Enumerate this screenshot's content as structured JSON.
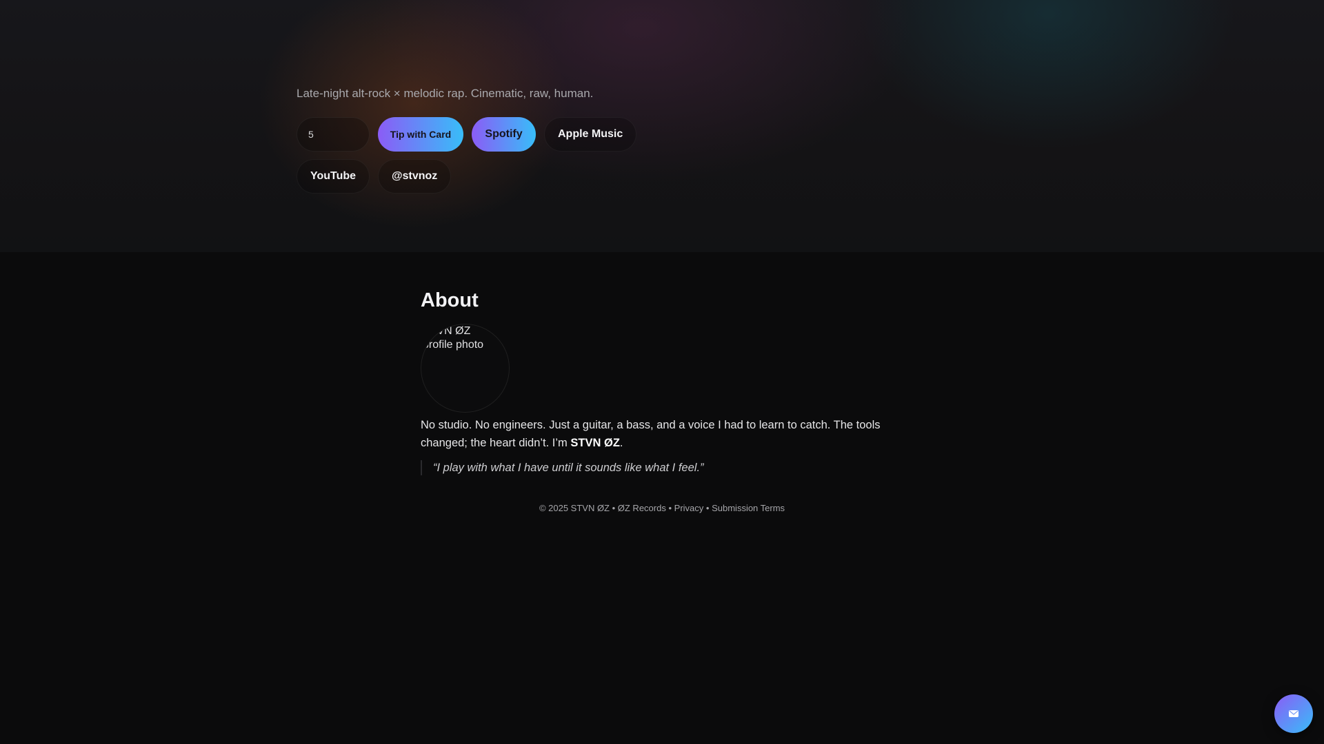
{
  "hero": {
    "tagline": "Late-night alt-rock × melodic rap. Cinematic, raw, human.",
    "tip_amount": "5",
    "tip_button_label": "Tip with Card",
    "links": {
      "spotify": "Spotify",
      "apple_music": "Apple Music",
      "youtube": "YouTube",
      "handle": "@stvnoz"
    }
  },
  "about": {
    "title": "About",
    "avatar_alt": "STVN ØZ profile photo",
    "bio_text": "No studio. No engineers. Just a guitar, a bass, and a voice I had to learn to catch. The tools changed; the heart didn’t. I’m ",
    "bio_name": "STVN ØZ",
    "bio_end": ".",
    "quote": "“I play with what I have until it sounds like what I feel.”"
  },
  "footer": {
    "copyright": "© 2025 STVN ØZ • ØZ Records",
    "separator": "•",
    "privacy": "Privacy",
    "terms": "Submission Terms"
  },
  "chat": {
    "icon": "chat-bubble-icon"
  },
  "colors": {
    "background": "#0b0b0c",
    "accent_start": "#8b5cf6",
    "accent_end": "#38bdf8"
  }
}
